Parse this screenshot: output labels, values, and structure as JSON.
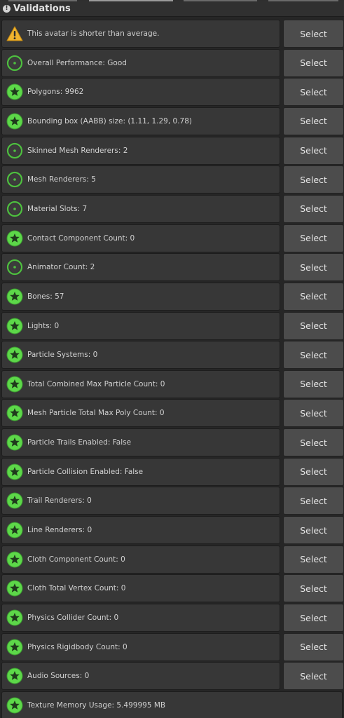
{
  "panel": {
    "header_icon": "info-icon",
    "title": "Validations"
  },
  "select_label": "Select",
  "colors": {
    "good": "#4ec03f",
    "excellent": "#5dd849",
    "warning": "#f0b32e",
    "row_bg": "#373737",
    "button_bg": "#4c4c4c"
  },
  "items": [
    {
      "icon": "warning-icon",
      "text": "This avatar is shorter than average.",
      "select": true
    },
    {
      "icon": "performance-good-icon",
      "text": "Overall Performance: Good",
      "select": true
    },
    {
      "icon": "star-icon",
      "text": "Polygons: 9962",
      "select": true
    },
    {
      "icon": "star-icon",
      "text": "Bounding box (AABB) size: (1.11, 1.29, 0.78)",
      "select": true
    },
    {
      "icon": "performance-good-icon",
      "text": "Skinned Mesh Renderers: 2",
      "select": true
    },
    {
      "icon": "performance-good-icon",
      "text": "Mesh Renderers: 5",
      "select": true
    },
    {
      "icon": "performance-good-icon",
      "text": "Material Slots: 7",
      "select": true
    },
    {
      "icon": "star-icon",
      "text": "Contact Component Count: 0",
      "select": true
    },
    {
      "icon": "performance-good-icon",
      "text": "Animator Count: 2",
      "select": true
    },
    {
      "icon": "star-icon",
      "text": "Bones: 57",
      "select": true
    },
    {
      "icon": "star-icon",
      "text": "Lights: 0",
      "select": true
    },
    {
      "icon": "star-icon",
      "text": "Particle Systems: 0",
      "select": true
    },
    {
      "icon": "star-icon",
      "text": "Total Combined Max Particle Count: 0",
      "select": true
    },
    {
      "icon": "star-icon",
      "text": "Mesh Particle Total Max Poly Count: 0",
      "select": true
    },
    {
      "icon": "star-icon",
      "text": "Particle Trails Enabled: False",
      "select": true
    },
    {
      "icon": "star-icon",
      "text": "Particle Collision Enabled: False",
      "select": true
    },
    {
      "icon": "star-icon",
      "text": "Trail Renderers: 0",
      "select": true
    },
    {
      "icon": "star-icon",
      "text": "Line Renderers: 0",
      "select": true
    },
    {
      "icon": "star-icon",
      "text": "Cloth Component Count: 0",
      "select": true
    },
    {
      "icon": "star-icon",
      "text": "Cloth Total Vertex Count: 0",
      "select": true
    },
    {
      "icon": "star-icon",
      "text": "Physics Collider Count: 0",
      "select": true
    },
    {
      "icon": "star-icon",
      "text": "Physics Rigidbody Count: 0",
      "select": true
    },
    {
      "icon": "star-icon",
      "text": "Audio Sources: 0",
      "select": true
    },
    {
      "icon": "star-icon",
      "text": "Texture Memory Usage: 5.499995 MB",
      "select": false
    }
  ]
}
